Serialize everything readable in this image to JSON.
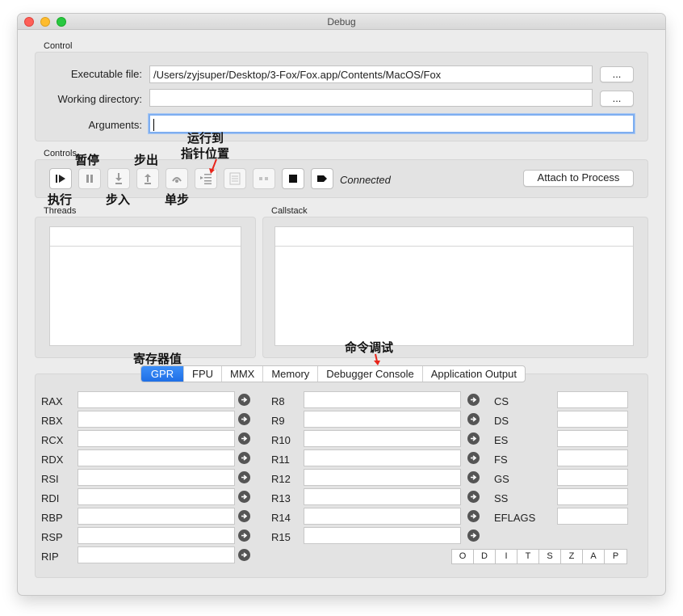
{
  "window": {
    "title": "Debug"
  },
  "control": {
    "section_label": "Control",
    "executable_label": "Executable file:",
    "executable_value": "/Users/zyjsuper/Desktop/3-Fox/Fox.app/Contents/MacOS/Fox",
    "working_dir_label": "Working directory:",
    "working_dir_value": "",
    "arguments_label": "Arguments:",
    "arguments_value": "",
    "browse_label": "..."
  },
  "controls": {
    "section_label": "Controls",
    "status": "Connected",
    "attach_label": "Attach to Process",
    "buttons": [
      "run",
      "pause",
      "step-into",
      "step-out",
      "step-over",
      "run-to-cursor",
      "disabled-a",
      "disabled-b",
      "stop",
      "detach"
    ]
  },
  "annotations": {
    "run": "执行",
    "pause": "暂停",
    "step_into": "步入",
    "step_out": "步出",
    "step_over": "单步",
    "run_to_line1": "运行到",
    "run_to_line2": "指针位置",
    "registers": "寄存器值",
    "console": "命令调试"
  },
  "threads": {
    "label": "Threads"
  },
  "callstack": {
    "label": "Callstack"
  },
  "tabs": [
    "GPR",
    "FPU",
    "MMX",
    "Memory",
    "Debugger Console",
    "Application Output"
  ],
  "registers": {
    "col1": [
      "RAX",
      "RBX",
      "RCX",
      "RDX",
      "RSI",
      "RDI",
      "RBP",
      "RSP",
      "RIP"
    ],
    "col2": [
      "R8",
      "R9",
      "R10",
      "R11",
      "R12",
      "R13",
      "R14",
      "R15"
    ],
    "col3": [
      "CS",
      "DS",
      "ES",
      "FS",
      "GS",
      "SS",
      "EFLAGS"
    ]
  },
  "flags": [
    "O",
    "D",
    "I",
    "T",
    "S",
    "Z",
    "A",
    "P"
  ],
  "colors": {
    "accent": "#1f6fe6",
    "annotation_arrow": "#e8241a"
  }
}
